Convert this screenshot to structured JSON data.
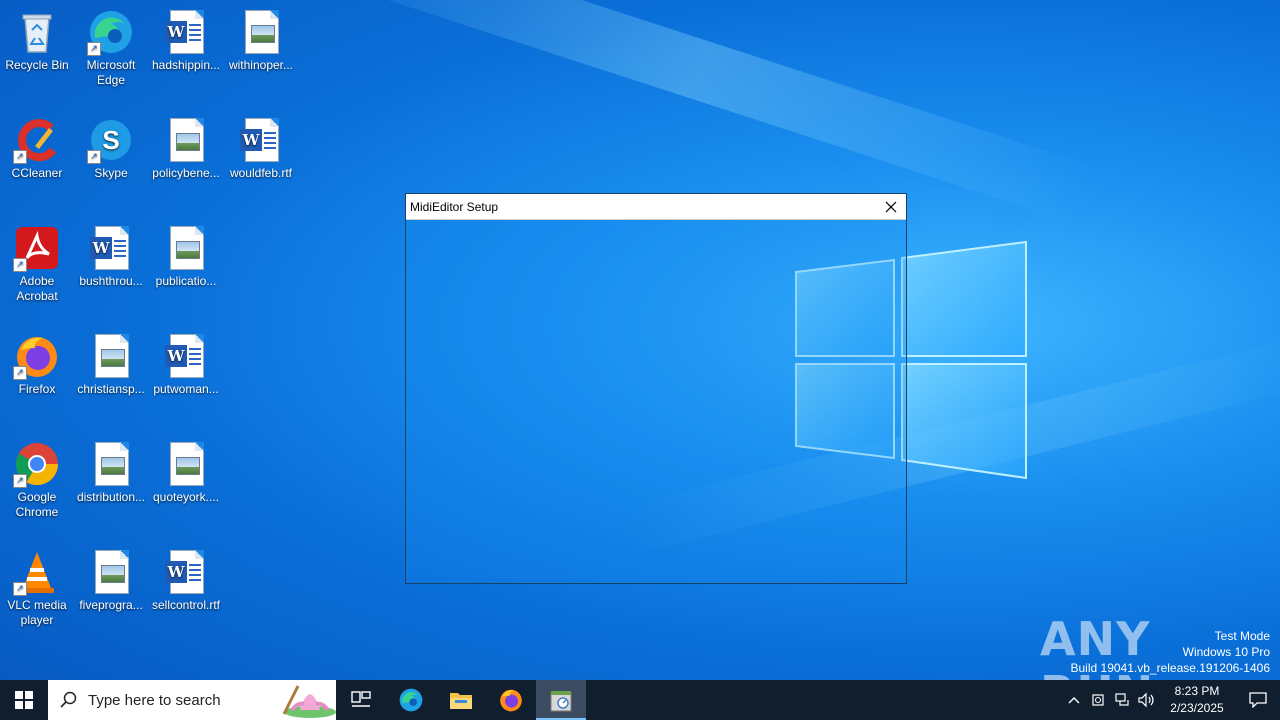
{
  "desktop": {
    "icons": [
      {
        "label": "Recycle Bin",
        "icon": "recycle-bin-icon"
      },
      {
        "label": "Microsoft Edge",
        "icon": "edge-icon"
      },
      {
        "label": "hadshippin...",
        "icon": "word-doc-icon"
      },
      {
        "label": "withinoper...",
        "icon": "image-file-icon"
      },
      {
        "label": "CCleaner",
        "icon": "ccleaner-icon"
      },
      {
        "label": "Skype",
        "icon": "skype-icon"
      },
      {
        "label": "policybene...",
        "icon": "image-file-icon"
      },
      {
        "label": "wouldfeb.rtf",
        "icon": "word-doc-icon"
      },
      {
        "label": "Adobe Acrobat",
        "icon": "acrobat-icon"
      },
      {
        "label": "bushthrou...",
        "icon": "word-doc-icon"
      },
      {
        "label": "publicatio...",
        "icon": "image-file-icon"
      },
      {
        "label": "Firefox",
        "icon": "firefox-icon"
      },
      {
        "label": "christiansp...",
        "icon": "image-file-icon"
      },
      {
        "label": "putwoman...",
        "icon": "word-doc-icon"
      },
      {
        "label": "Google Chrome",
        "icon": "chrome-icon"
      },
      {
        "label": "distribution...",
        "icon": "image-file-icon"
      },
      {
        "label": "quoteyork....",
        "icon": "image-file-icon"
      },
      {
        "label": "VLC media player",
        "icon": "vlc-icon"
      },
      {
        "label": "fiveprogra...",
        "icon": "image-file-icon"
      },
      {
        "label": "sellcontrol.rtf",
        "icon": "word-doc-icon"
      }
    ]
  },
  "window": {
    "title": "MidiEditor Setup"
  },
  "watermark": {
    "brand": "ANY RUN",
    "line1": "Test Mode",
    "line2": "Windows 10 Pro",
    "line3": "Build 19041.vb_release.191206-1406"
  },
  "taskbar": {
    "search_placeholder": "Type here to search",
    "apps": [
      "task-view-icon",
      "edge-icon",
      "file-explorer-icon",
      "firefox-icon",
      "setup-installer-icon"
    ],
    "clock_time": "8:23 PM",
    "clock_date": "2/23/2025"
  }
}
